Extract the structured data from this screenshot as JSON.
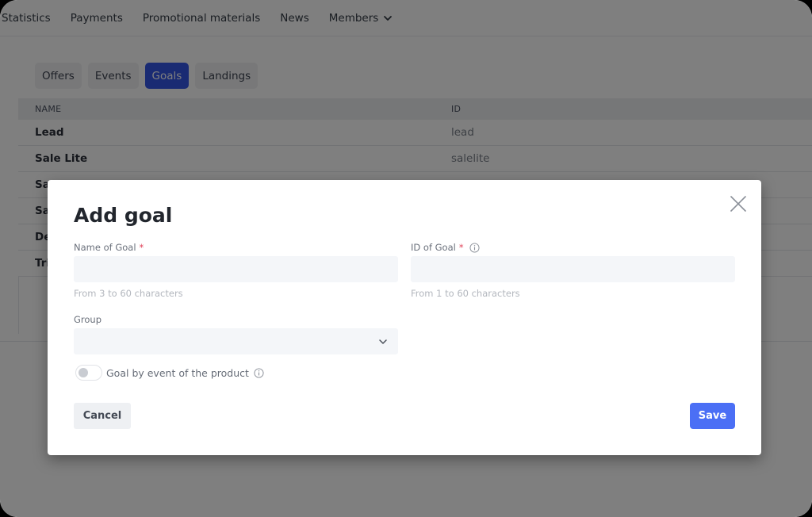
{
  "nav": {
    "items": [
      {
        "label": "Statistics"
      },
      {
        "label": "Payments"
      },
      {
        "label": "Promotional materials"
      },
      {
        "label": "News"
      },
      {
        "label": "Members",
        "has_dropdown": true,
        "icon": "chevron-down-icon"
      }
    ]
  },
  "tabs": [
    {
      "label": "Offers",
      "active": false
    },
    {
      "label": "Events",
      "active": false
    },
    {
      "label": "Goals",
      "active": true
    },
    {
      "label": "Landings",
      "active": false
    }
  ],
  "table": {
    "columns": [
      "NAME",
      "ID"
    ],
    "rows": [
      {
        "name": "Lead",
        "id": "lead"
      },
      {
        "name": "Sale Lite",
        "id": "salelite"
      },
      {
        "name": "Sa",
        "id": ""
      },
      {
        "name": "Sa",
        "id": ""
      },
      {
        "name": "De",
        "id": ""
      },
      {
        "name": "Tri",
        "id": ""
      }
    ]
  },
  "modal": {
    "title": "Add goal",
    "close_icon": "close-icon",
    "name_field": {
      "label": "Name of Goal",
      "required_mark": "*",
      "value": "",
      "placeholder": "",
      "hint": "From 3 to 60 characters"
    },
    "id_field": {
      "label": "ID of Goal",
      "required_mark": "*",
      "info_icon": "info-icon",
      "value": "",
      "placeholder": "",
      "hint": "From 1 to 60 characters"
    },
    "group_field": {
      "label": "Group",
      "selected": "",
      "icon": "chevron-down-icon"
    },
    "toggle": {
      "label": "Goal by event of the product",
      "enabled": false,
      "info_icon": "info-icon"
    },
    "cancel_label": "Cancel",
    "save_label": "Save"
  },
  "colors": {
    "accent": "#3456e6",
    "save_button": "#4b6ff5",
    "required": "#e0445a",
    "overlay": "rgba(0,0,0,0.5)"
  }
}
